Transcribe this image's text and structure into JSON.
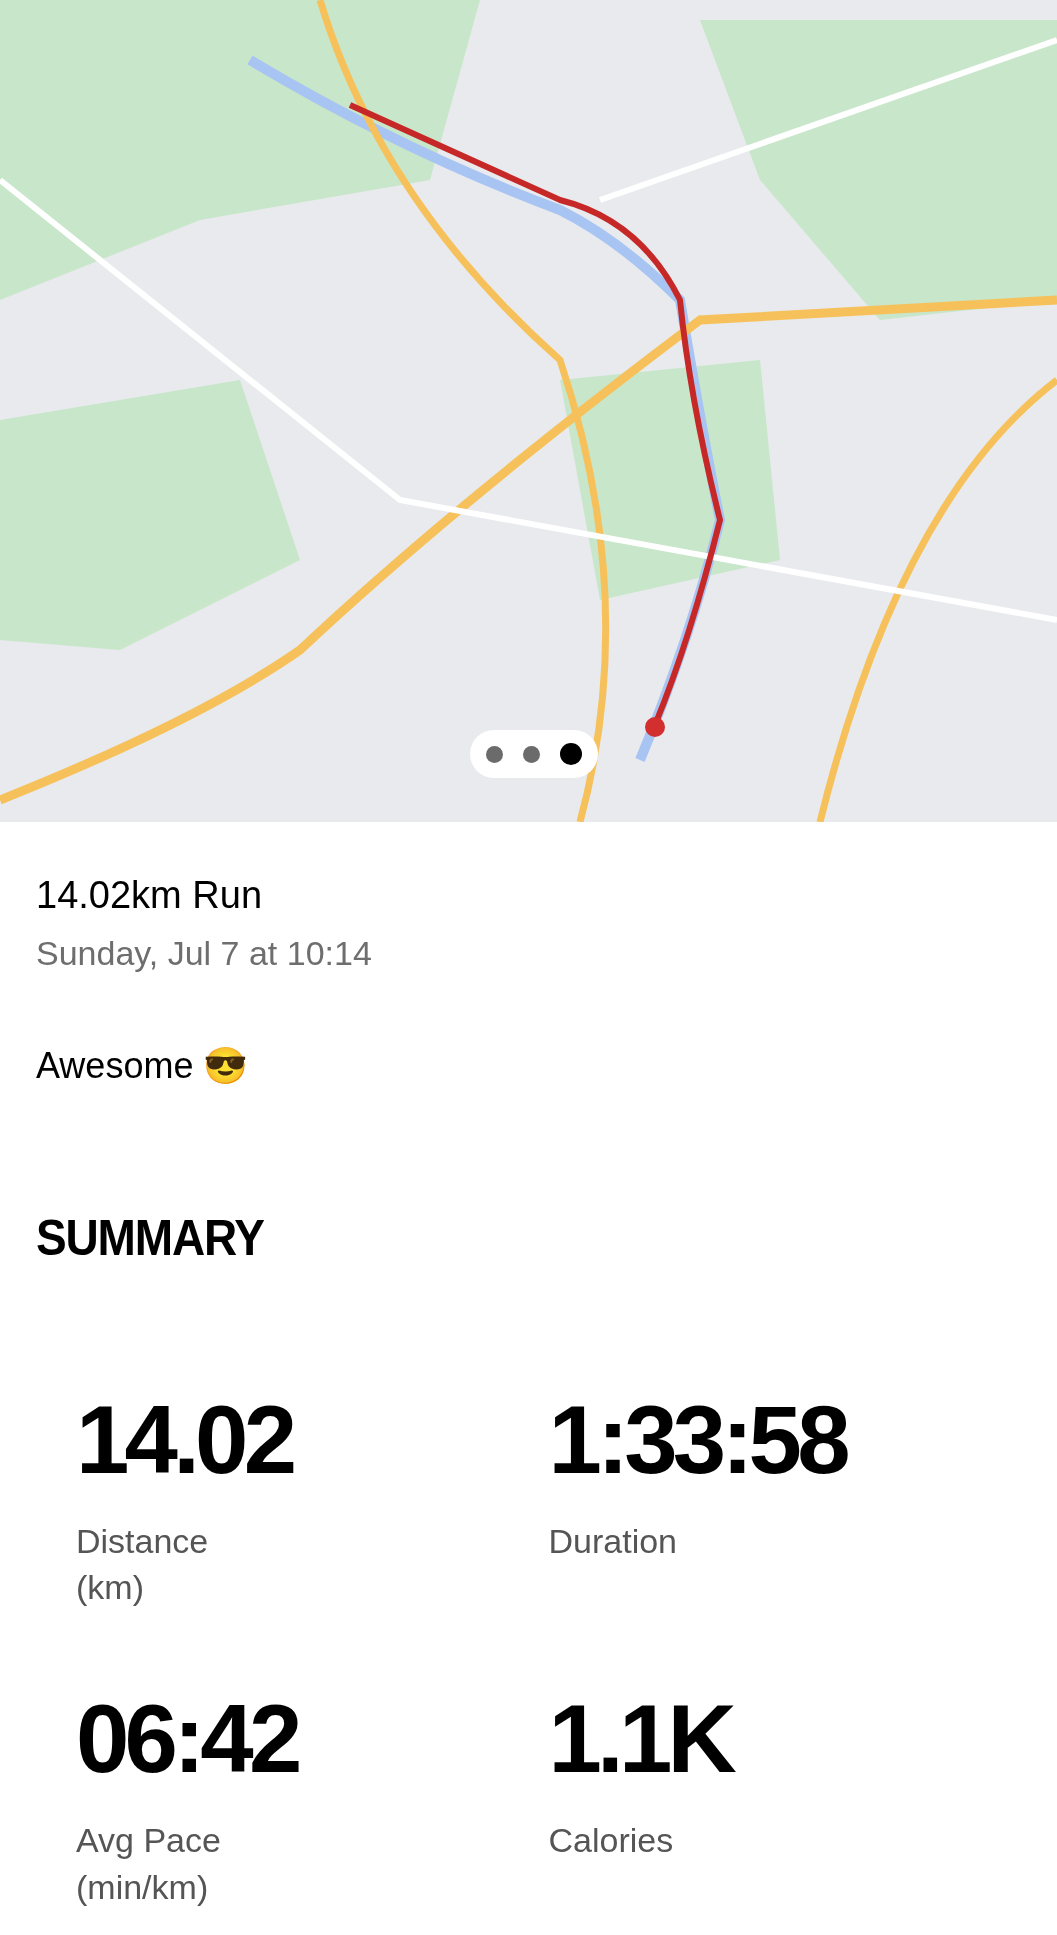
{
  "map": {
    "kind": "picture",
    "pager": [
      {
        "selected": false
      },
      {
        "selected": false
      },
      {
        "selected": true
      }
    ]
  },
  "activity": {
    "title": "14.02km Run",
    "datetime": "Sunday, Jul 7 at 10:14",
    "note": "Awesome 😎"
  },
  "summary": {
    "heading": "SUMMARY",
    "stats": [
      {
        "value": "14.02",
        "label": "Distance",
        "unit": "(km)"
      },
      {
        "value": "1:33:58",
        "label": "Duration"
      },
      {
        "value": "06:42",
        "label": "Avg Pace",
        "unit": "(min/km)"
      },
      {
        "value": "1.1K",
        "label": "Calories"
      }
    ]
  }
}
